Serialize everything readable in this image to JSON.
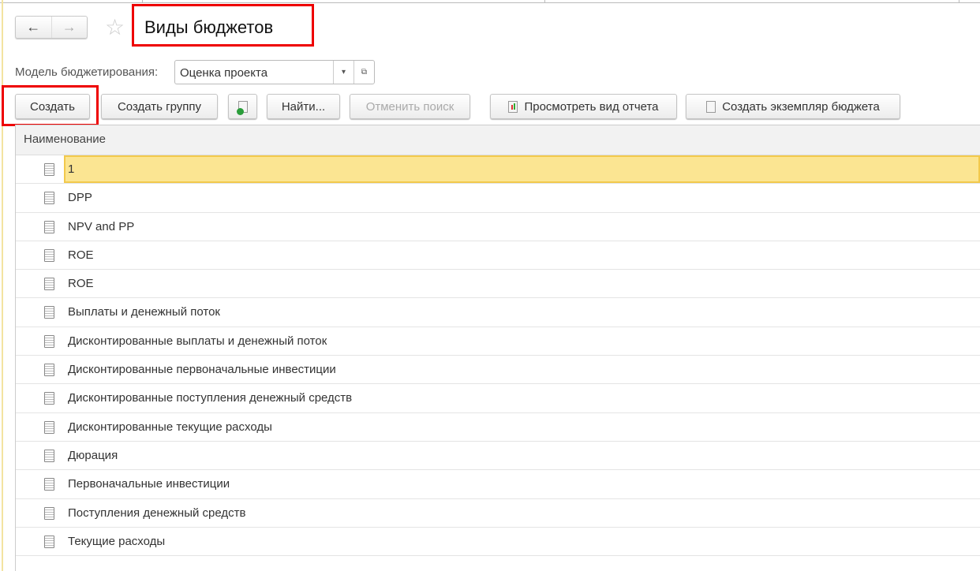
{
  "header": {
    "title": "Виды  бюджетов",
    "back": "←",
    "forward": "→",
    "favorite": "☆"
  },
  "filter": {
    "label": "Модель бюджетирования:",
    "value": "Оценка проекта",
    "dropdown": "▾",
    "open": "⧉"
  },
  "toolbar": {
    "create": "Создать",
    "create_group": "Создать группу",
    "find": "Найти...",
    "cancel_search": "Отменить поиск",
    "view_report": "Просмотреть вид отчета",
    "create_instance": "Создать экземпляр бюджета"
  },
  "table": {
    "column": "Наименование",
    "rows": [
      "1",
      "DPP",
      "NPV and PP",
      "ROE",
      "ROE",
      "Выплаты и денежный поток",
      "Дисконтированные выплаты и денежный поток",
      "Дисконтированные первоначальные инвестиции",
      "Дисконтированные поступления денежный средств",
      "Дисконтированные текущие расходы",
      "Дюрация",
      "Первоначальные инвестиции",
      "Поступления денежный средств",
      "Текущие расходы"
    ],
    "selected_index": 0
  }
}
